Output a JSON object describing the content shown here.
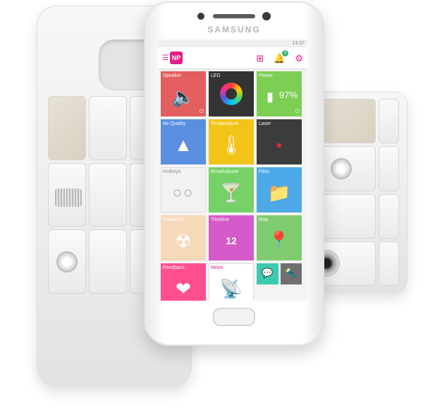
{
  "colors": {
    "accent": "#e21e8a",
    "speaker": "#e35e5e",
    "led": "#333333",
    "power": "#7ccf53",
    "air_quality": "#5a8fe0",
    "temperature": "#f2c418",
    "laser": "#3c3c3c",
    "hotkeys": "#f2f2f2",
    "breathalyzer": "#76d266",
    "files": "#4ea9e8",
    "radiation": "#f5d9b8",
    "timeline": "#d65ac9",
    "map": "#7fcc70",
    "feedback": "#ff4f8f",
    "news": "#ffffff",
    "chat": "#3dc9b0",
    "flashlight": "#6f6f6f"
  },
  "phone": {
    "brand": "SAMSUNG",
    "status_time": "13:37"
  },
  "appbar": {
    "logo_text": "NP",
    "menu_icon": "hamburger-icon",
    "add_icon": "plus-square-icon",
    "bell_icon": "bell-icon",
    "bell_badge": "1",
    "settings_icon": "gear-icon"
  },
  "tiles": {
    "speaker": {
      "label": "Speaker",
      "icon": "speaker-icon"
    },
    "led": {
      "label": "LED",
      "icon": "color-wheel-icon"
    },
    "power": {
      "label": "Power",
      "value": "97%",
      "icon": "battery-icon"
    },
    "air_quality": {
      "label": "Air Quality",
      "icon": "pyramid-icon"
    },
    "temperature": {
      "label": "Temperature",
      "icon": "thermometer-icon"
    },
    "laser": {
      "label": "Laser",
      "icon": "laser-dot-icon"
    },
    "hotkeys": {
      "label": "Hotkeys",
      "icon": "two-circles-icon"
    },
    "breathalyzer": {
      "label": "Breathalyzer",
      "icon": "cocktail-icon"
    },
    "files": {
      "label": "Files",
      "icon": "folder-icon"
    },
    "radiation": {
      "label": "Radiation",
      "icon": "radiation-icon"
    },
    "timeline": {
      "label": "Timeline",
      "day": "12",
      "icon": "calendar-icon"
    },
    "map": {
      "label": "Map",
      "icon": "map-pin-icon"
    },
    "feedback": {
      "label": "Feedback",
      "icon": "heart-icon"
    },
    "news": {
      "label": "News",
      "icon": "antenna-icon"
    },
    "chat": {
      "icon": "chat-icon"
    },
    "flashlight": {
      "icon": "flashlight-icon"
    }
  }
}
